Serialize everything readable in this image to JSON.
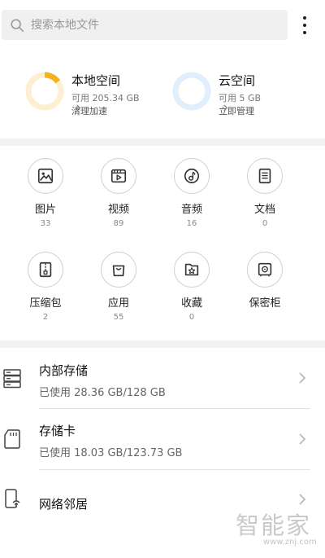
{
  "search": {
    "placeholder": "搜索本地文件"
  },
  "spaces": [
    {
      "name": "本地空间",
      "info": "可用 205.34 GB",
      "action": "清理加速",
      "usage_fraction": 0.15,
      "ring_color": "#f5b31b",
      "track_color": "#fdf0d2"
    },
    {
      "name": "云空间",
      "info": "可用 5 GB",
      "action": "立即管理",
      "usage_fraction": 0.0,
      "ring_color": "#5aa9f5",
      "track_color": "#e1eefc"
    }
  ],
  "categories": [
    {
      "label": "图片",
      "count": "33",
      "icon": "image-icon"
    },
    {
      "label": "视频",
      "count": "89",
      "icon": "video-icon"
    },
    {
      "label": "音频",
      "count": "16",
      "icon": "audio-icon"
    },
    {
      "label": "文档",
      "count": "0",
      "icon": "document-icon"
    },
    {
      "label": "压缩包",
      "count": "2",
      "icon": "archive-icon"
    },
    {
      "label": "应用",
      "count": "55",
      "icon": "app-bag-icon"
    },
    {
      "label": "收藏",
      "count": "0",
      "icon": "favorites-icon"
    },
    {
      "label": "保密柜",
      "count": "",
      "icon": "safe-icon"
    }
  ],
  "storage": [
    {
      "title": "内部存储",
      "detail": "已使用 28.36 GB/128 GB",
      "icon": "server-icon"
    },
    {
      "title": "存储卡",
      "detail": "已使用 18.03 GB/123.73 GB",
      "icon": "sd-card-icon"
    },
    {
      "title": "网络邻居",
      "detail": "",
      "icon": "network-device-icon"
    }
  ],
  "watermark": {
    "main": "智能家",
    "url": "www.znj.com"
  }
}
